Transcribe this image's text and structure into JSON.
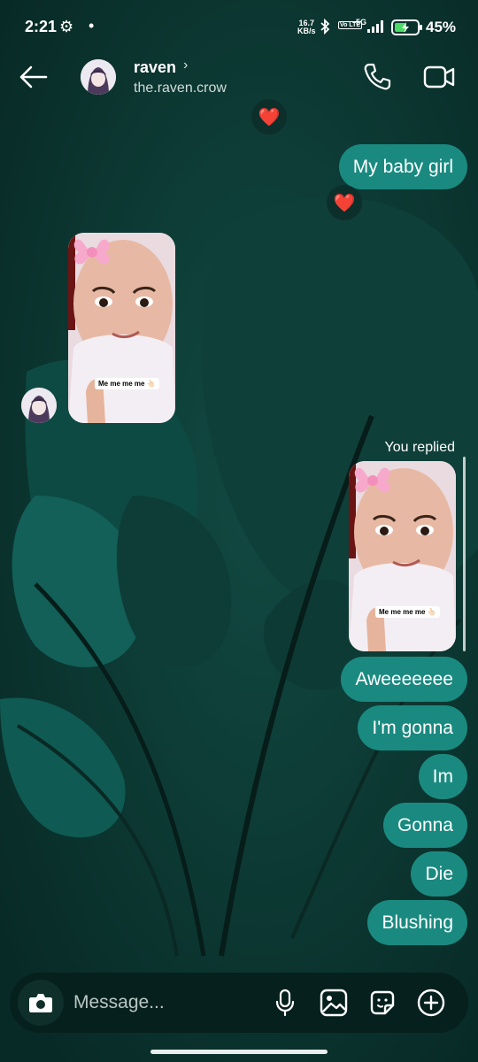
{
  "colors": {
    "background": "#0b3530",
    "bubble": "#1a8a80",
    "heart": "#ff2d3d",
    "composer": "#06201d"
  },
  "status_bar": {
    "time": "2:21",
    "settings_icon": "gear-icon",
    "notif_dot": "•",
    "net_speed_value": "16.7",
    "net_speed_unit": "KB/s",
    "volte": "Vo LTE",
    "network": "5G",
    "battery": "45%"
  },
  "header": {
    "name": "raven",
    "chevron": "›",
    "username": "the.raven.crow",
    "icons": [
      "back-arrow-icon",
      "phone-icon",
      "video-camera-icon"
    ]
  },
  "messages": {
    "sent_1": "My baby girl",
    "reaction": "❤️",
    "story_caption": "Me me me me 👆🏻",
    "you_replied": "You replied",
    "bubbles": [
      "Aweeeeeee",
      "I'm gonna",
      "Im",
      "Gonna",
      "Die",
      "Blushing"
    ]
  },
  "composer": {
    "placeholder": "Message...",
    "icons": [
      "camera-icon",
      "microphone-icon",
      "image-icon",
      "sticker-icon",
      "plus-circle-icon"
    ]
  }
}
